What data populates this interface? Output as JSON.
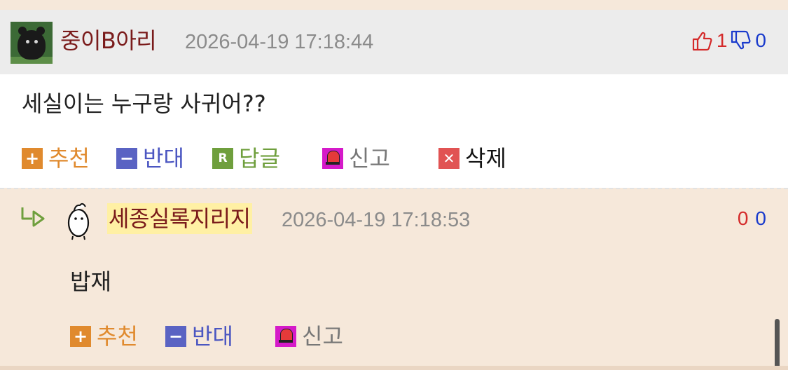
{
  "comment": {
    "nickname": "중이B아리",
    "timestamp": "2026-04-19 17:18:44",
    "upvotes": "1",
    "downvotes": "0",
    "text": "세실이는 누구랑 사귀어??",
    "actions": {
      "recommend": "추천",
      "oppose": "반대",
      "reply": "답글",
      "report": "신고",
      "delete": "삭제"
    }
  },
  "reply": {
    "nickname": "세종실록지리지",
    "timestamp": "2026-04-19 17:18:53",
    "upvotes": "0",
    "downvotes": "0",
    "text": "밥재",
    "actions": {
      "recommend": "추천",
      "oppose": "반대",
      "report": "신고"
    }
  },
  "colors": {
    "nickname": "#7a1b1b",
    "upvote": "#d42a2a",
    "downvote": "#1a3bcc",
    "reply_background": "#f6e8da",
    "nickname_highlight": "#fff0a4"
  },
  "icons": {
    "thumbs_up": "thumbs-up-icon",
    "thumbs_down": "thumbs-down-icon",
    "plus": "plus-icon",
    "minus": "minus-icon",
    "reply": "reply-icon",
    "report": "alarm-bell-icon",
    "delete": "close-icon",
    "reply_arrow": "reply-arrow-icon"
  }
}
